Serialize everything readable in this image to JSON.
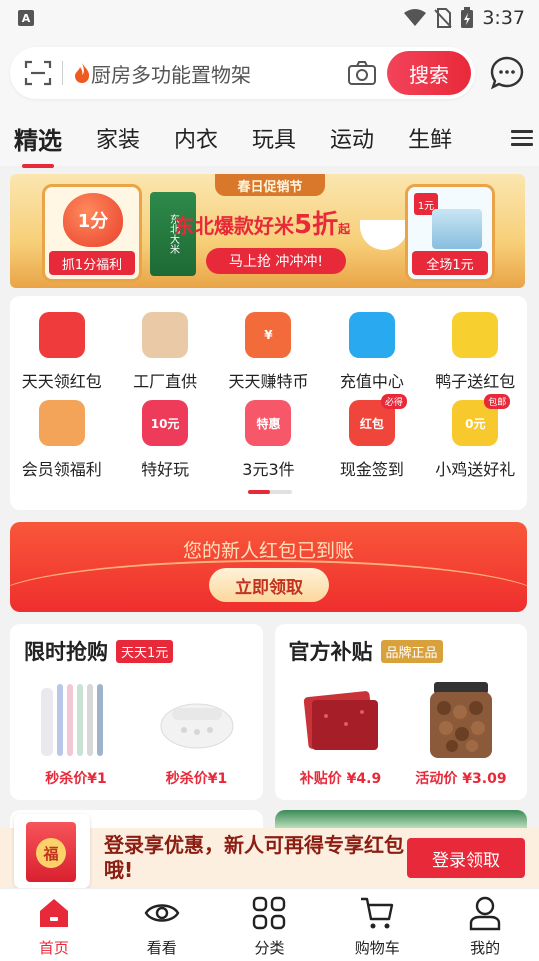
{
  "status_bar": {
    "time": "3:37"
  },
  "search": {
    "placeholder_text": "厨房多功能置物架",
    "button_label": "搜索"
  },
  "tabs": [
    {
      "label": "精选",
      "active": true
    },
    {
      "label": "家装"
    },
    {
      "label": "内衣"
    },
    {
      "label": "玩具"
    },
    {
      "label": "运动"
    },
    {
      "label": "生鲜"
    }
  ],
  "banner": {
    "ribbon": "春日促销节",
    "left_amount": "1分",
    "left_label": "抓1分福利",
    "rice_bag_text": "东北大米",
    "headline_prefix": "东北爆款好米",
    "headline_big": "5折",
    "headline_suffix": "起",
    "cta": "马上抢 冲冲冲!",
    "right_tag": "1元",
    "right_label": "全场1元"
  },
  "quick_icons": [
    {
      "label": "天天领红包",
      "color": "#ef3b3b"
    },
    {
      "label": "工厂直供",
      "color": "#e9c9a6"
    },
    {
      "label": "天天赚特币",
      "color": "#f36b3b",
      "badge": "¥"
    },
    {
      "label": "充值中心",
      "color": "#29a9f0"
    },
    {
      "label": "鸭子送红包",
      "color": "#f7cf2e"
    },
    {
      "label": "会员领福利",
      "color": "#f3a458"
    },
    {
      "label": "特好玩",
      "color": "#ef3b5a",
      "badge": "10元"
    },
    {
      "label": "3元3件",
      "color": "#f6586a",
      "badge": "特惠"
    },
    {
      "label": "现金签到",
      "color": "#f0453a",
      "badge": "红包",
      "corner": "必得"
    },
    {
      "label": "小鸡送好礼",
      "color": "#f8c92c",
      "badge": "0元",
      "corner": "包邮"
    }
  ],
  "red_packet": {
    "title": "您的新人红包已到账",
    "button": "立即领取"
  },
  "flash_sale": {
    "title": "限时抢购",
    "badge": "天天1元",
    "products": [
      {
        "price": "秒杀价¥1"
      },
      {
        "price": "秒杀价¥1"
      }
    ]
  },
  "subsidy": {
    "title": "官方补贴",
    "badge": "品牌正品",
    "products": [
      {
        "price": "补贴价 ¥4.9"
      },
      {
        "price": "活动价 ¥3.09"
      }
    ]
  },
  "login_bar": {
    "emblem": "福",
    "text": "登录享优惠，新人可再得专享红包哦!",
    "button": "登录领取"
  },
  "bottom_nav": [
    {
      "label": "首页",
      "icon": "home-icon",
      "active": true
    },
    {
      "label": "看看",
      "icon": "eye-icon"
    },
    {
      "label": "分类",
      "icon": "grid-icon"
    },
    {
      "label": "购物车",
      "icon": "cart-icon"
    },
    {
      "label": "我的",
      "icon": "user-icon"
    }
  ],
  "colors": {
    "brand_red": "#e8293a",
    "gold": "#d9a13c"
  }
}
